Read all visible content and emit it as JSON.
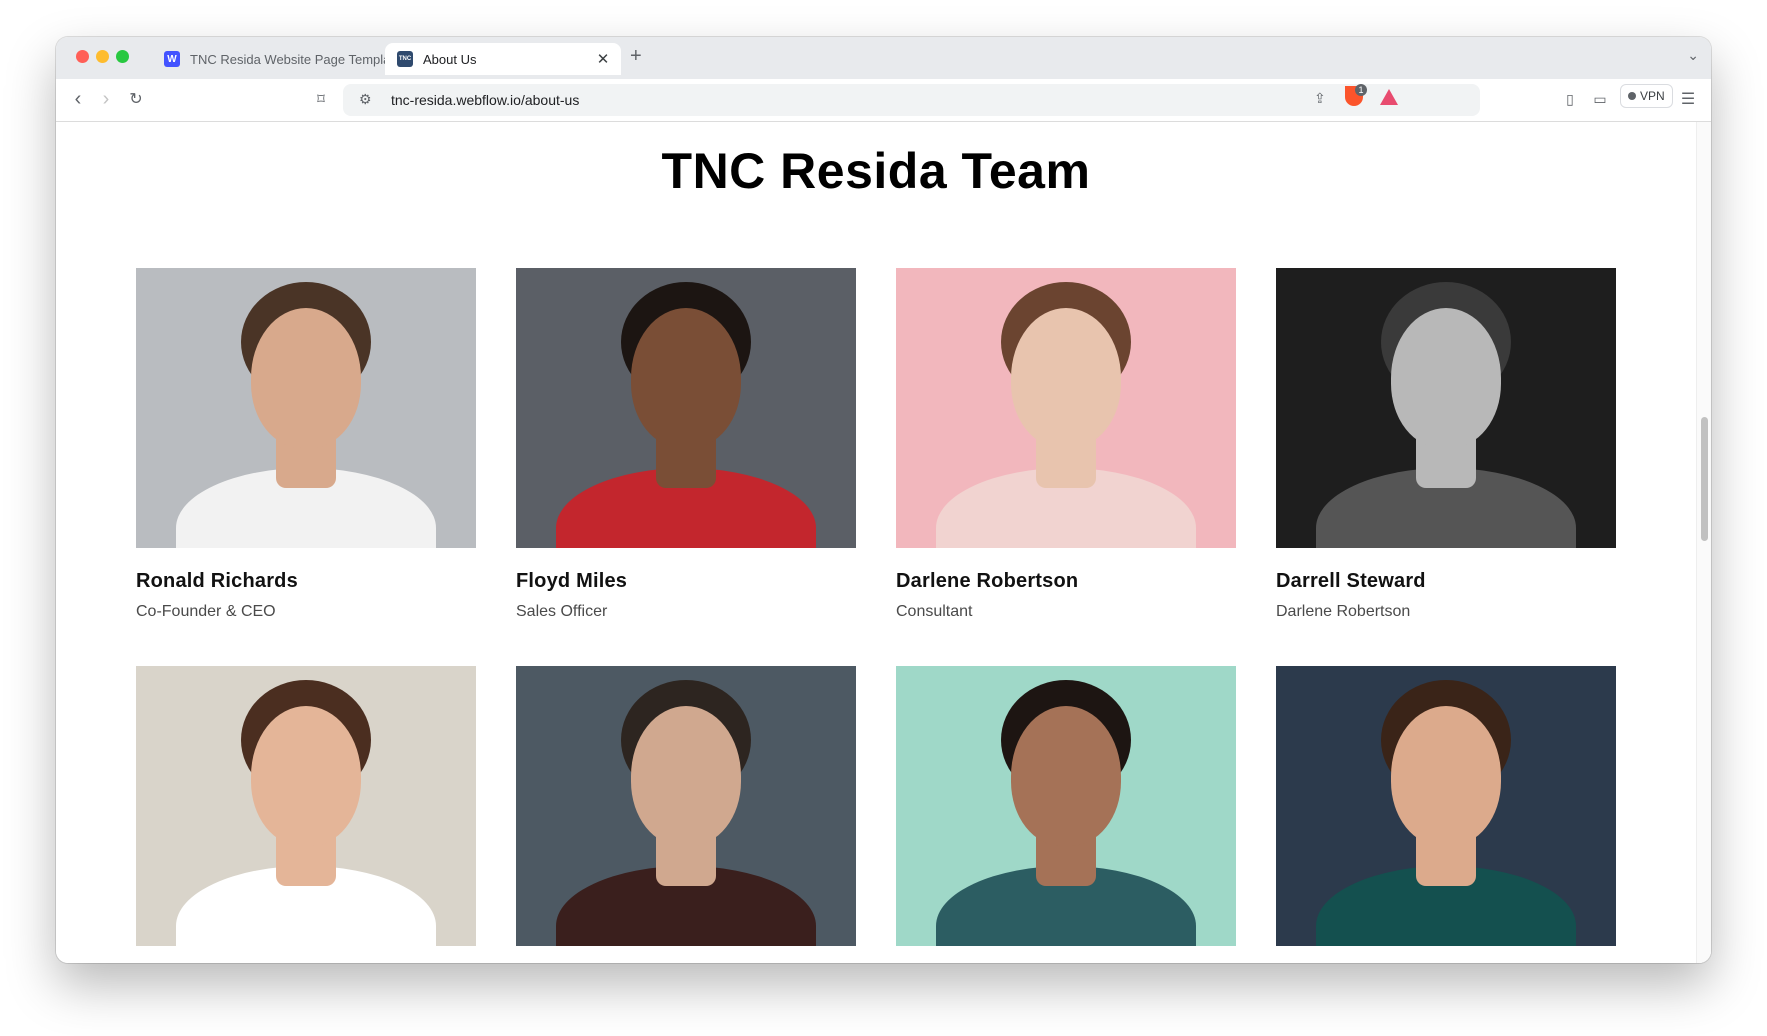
{
  "browser": {
    "tabs": [
      {
        "title": "TNC Resida Website Page Template",
        "favicon": "W",
        "active": false
      },
      {
        "title": "About Us",
        "favicon": "TNC",
        "active": true
      }
    ],
    "new_tab_icon": "+",
    "url": "tnc-resida.webflow.io/about-us",
    "vpn_label": "VPN",
    "shield_badge": "1"
  },
  "page": {
    "title": "TNC Resida Team",
    "members": [
      {
        "name": "Ronald Richards",
        "role": "Co-Founder & CEO",
        "bg": "#b9bcc0",
        "skin": "#d8a98c",
        "hair": "#4a3426",
        "shirt": "#f2f2f2"
      },
      {
        "name": "Floyd Miles",
        "role": "Sales Officer",
        "bg": "#5b5f66",
        "skin": "#7a4e36",
        "hair": "#1c1512",
        "shirt": "#c3262d"
      },
      {
        "name": "Darlene Robertson",
        "role": "Consultant",
        "bg": "#f2b7bd",
        "skin": "#e8c4ae",
        "hair": "#6b4430",
        "shirt": "#f1d3d0"
      },
      {
        "name": "Darrell Steward",
        "role": "Darlene Robertson",
        "bg": "#1e1e1e",
        "skin": "#b8b8b8",
        "hair": "#3a3a3a",
        "shirt": "#555555"
      },
      {
        "name": "",
        "role": "",
        "bg": "#d9d4ca",
        "skin": "#e4b598",
        "hair": "#4b2e20",
        "shirt": "#ffffff"
      },
      {
        "name": "",
        "role": "",
        "bg": "#4d5963",
        "skin": "#d0a88f",
        "hair": "#2d2520",
        "shirt": "#3a1f1d"
      },
      {
        "name": "",
        "role": "",
        "bg": "#9fd8c8",
        "skin": "#a57257",
        "hair": "#1d1512",
        "shirt": "#2c5d62"
      },
      {
        "name": "",
        "role": "",
        "bg": "#2c3a4c",
        "skin": "#dcaa8c",
        "hair": "#3a2418",
        "shirt": "#14504f"
      }
    ]
  }
}
